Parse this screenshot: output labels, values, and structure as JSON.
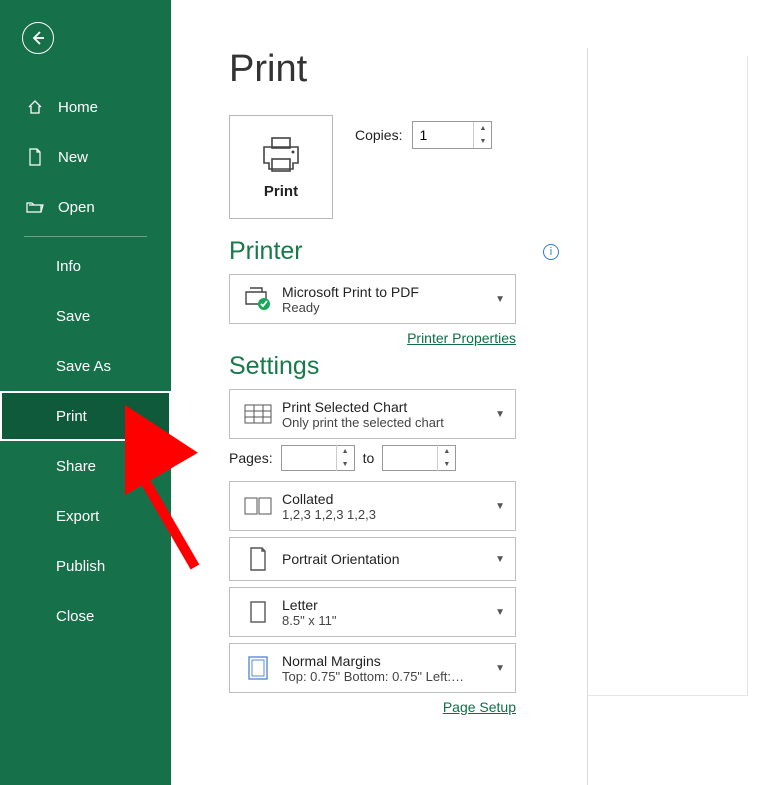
{
  "sidebar": {
    "top": [
      {
        "label": "Home"
      },
      {
        "label": "New"
      },
      {
        "label": "Open"
      }
    ],
    "sub": [
      {
        "label": "Info"
      },
      {
        "label": "Save"
      },
      {
        "label": "Save As"
      },
      {
        "label": "Print",
        "selected": true
      },
      {
        "label": "Share"
      },
      {
        "label": "Export"
      },
      {
        "label": "Publish"
      },
      {
        "label": "Close"
      }
    ]
  },
  "main": {
    "title": "Print",
    "print_button_label": "Print",
    "copies_label": "Copies:",
    "copies_value": "1"
  },
  "printer": {
    "heading": "Printer",
    "name": "Microsoft Print to PDF",
    "status": "Ready",
    "properties_link": "Printer Properties"
  },
  "settings": {
    "heading": "Settings",
    "scope": {
      "title": "Print Selected Chart",
      "sub": "Only print the selected chart"
    },
    "pages_label": "Pages:",
    "pages_to": "to",
    "pages_from": "",
    "pages_to_value": "",
    "collate": {
      "title": "Collated",
      "sub": "1,2,3    1,2,3    1,2,3"
    },
    "orientation": {
      "title": "Portrait Orientation"
    },
    "paper": {
      "title": "Letter",
      "sub": "8.5\" x 11\""
    },
    "margins": {
      "title": "Normal Margins",
      "sub": "Top: 0.75\" Bottom: 0.75\" Left:…"
    },
    "page_setup_link": "Page Setup"
  }
}
